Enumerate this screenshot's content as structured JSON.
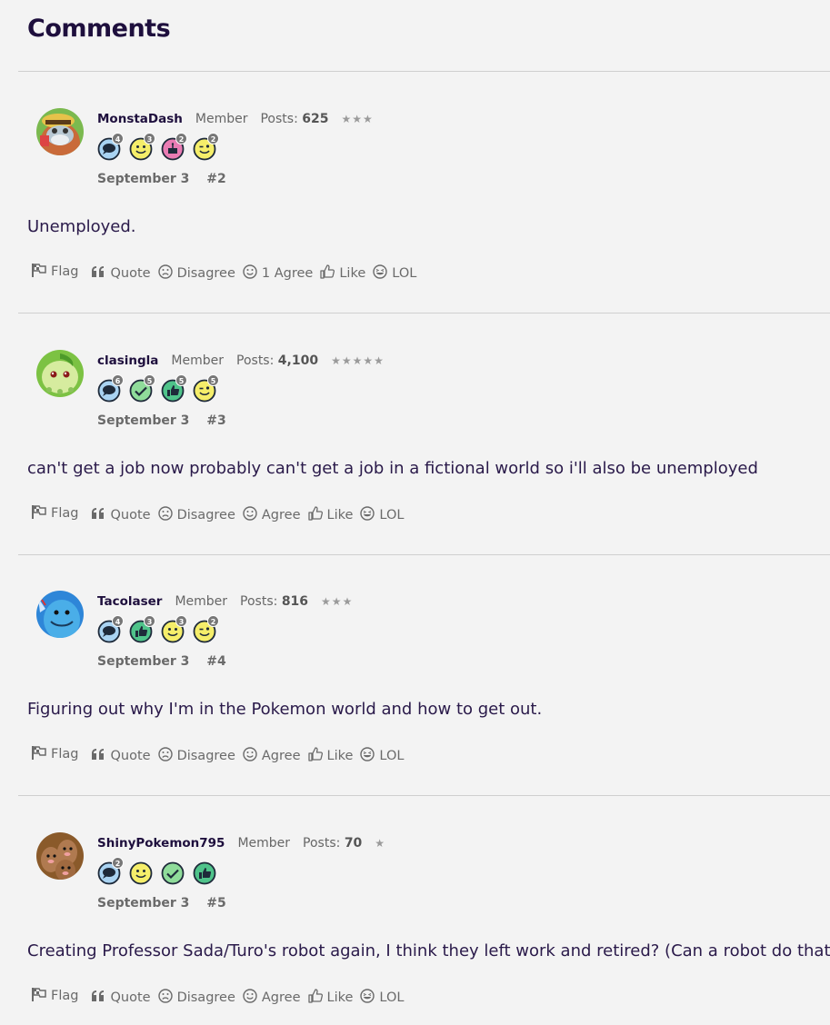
{
  "heading": "Comments",
  "actions": {
    "flag": "Flag",
    "quote": "Quote",
    "disagree": "Disagree",
    "like": "Like",
    "lol": "LOL"
  },
  "comments": [
    {
      "username": "MonstaDash",
      "role": "Member",
      "posts_label": "Posts:",
      "posts": "625",
      "stars": "★★★",
      "avatar": "bearded-explorer-avatar",
      "badges": [
        {
          "icon": "speech-bubble-icon",
          "count": "4",
          "color": "#a9d3f2"
        },
        {
          "icon": "smiley-icon",
          "count": "3",
          "color": "#f5ee6a"
        },
        {
          "icon": "cake-icon",
          "count": "2",
          "color": "#e97cb3"
        },
        {
          "icon": "wink-icon",
          "count": "2",
          "color": "#f5ee6a"
        }
      ],
      "date": "September 3",
      "number": "#2",
      "text": "Unemployed.",
      "agree_label": "1 Agree"
    },
    {
      "username": "clasingla",
      "role": "Member",
      "posts_label": "Posts:",
      "posts": "4,100",
      "stars": "★★★★★",
      "avatar": "chikorita-avatar",
      "badges": [
        {
          "icon": "speech-bubble-icon",
          "count": "6",
          "color": "#a9d3f2"
        },
        {
          "icon": "checkmark-icon",
          "count": "5",
          "color": "#8fdc9a"
        },
        {
          "icon": "thumbs-up-icon",
          "count": "5",
          "color": "#4fc38a"
        },
        {
          "icon": "wink-icon",
          "count": "5",
          "color": "#f5ee6a"
        }
      ],
      "date": "September 3",
      "number": "#3",
      "text": "can't get a job now probably can't get a job in a fictional world so i'll also be unemployed",
      "agree_label": "Agree"
    },
    {
      "username": "Tacolaser",
      "role": "Member",
      "posts_label": "Posts:",
      "posts": "816",
      "stars": "★★★",
      "avatar": "quagsire-avatar",
      "badges": [
        {
          "icon": "speech-bubble-icon",
          "count": "4",
          "color": "#a9d3f2"
        },
        {
          "icon": "thumbs-up-icon",
          "count": "3",
          "color": "#4fc38a"
        },
        {
          "icon": "smiley-icon",
          "count": "3",
          "color": "#f5ee6a"
        },
        {
          "icon": "wink-icon",
          "count": "2",
          "color": "#f5ee6a"
        }
      ],
      "date": "September 3",
      "number": "#4",
      "text": "Figuring out why I'm in the Pokemon world and how to get out.",
      "agree_label": "Agree"
    },
    {
      "username": "ShinyPokemon795",
      "role": "Member",
      "posts_label": "Posts:",
      "posts": "70",
      "stars": "★",
      "avatar": "dugtrio-avatar",
      "badges": [
        {
          "icon": "speech-bubble-icon",
          "count": "2",
          "color": "#a9d3f2"
        },
        {
          "icon": "smiley-icon",
          "count": "",
          "color": "#f5ee6a"
        },
        {
          "icon": "checkmark-icon",
          "count": "",
          "color": "#8fdc9a"
        },
        {
          "icon": "thumbs-up-icon",
          "count": "",
          "color": "#4fc38a"
        }
      ],
      "date": "September 3",
      "number": "#5",
      "text": "Creating Professor Sada/Turo's robot again, I think they left work and retired? (Can a robot do that?)",
      "agree_label": "Agree"
    }
  ]
}
